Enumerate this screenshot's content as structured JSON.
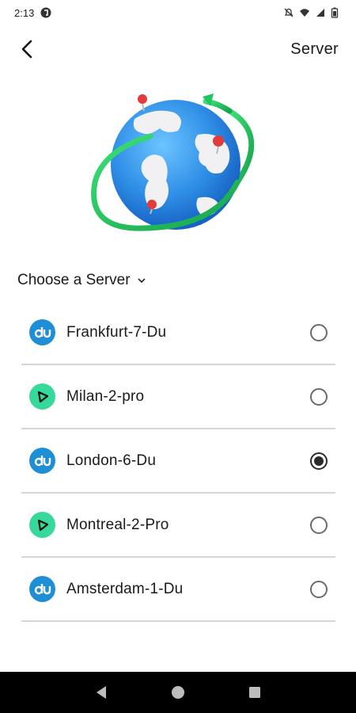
{
  "status_bar": {
    "time": "2:13"
  },
  "header": {
    "title": "Server"
  },
  "section": {
    "choose_label": "Choose a Server"
  },
  "servers": [
    {
      "name": "Frankfurt-7-Du",
      "provider": "du",
      "selected": false
    },
    {
      "name": "Milan-2-pro",
      "provider": "pro",
      "selected": false
    },
    {
      "name": "London-6-Du",
      "provider": "du",
      "selected": true
    },
    {
      "name": "Montreal-2-Pro",
      "provider": "pro",
      "selected": false
    },
    {
      "name": "Amsterdam-1-Du",
      "provider": "du",
      "selected": false
    }
  ],
  "colors": {
    "du": "#1e8fd6",
    "pro": "#37d99a",
    "globe_ring": "#22c55e"
  }
}
